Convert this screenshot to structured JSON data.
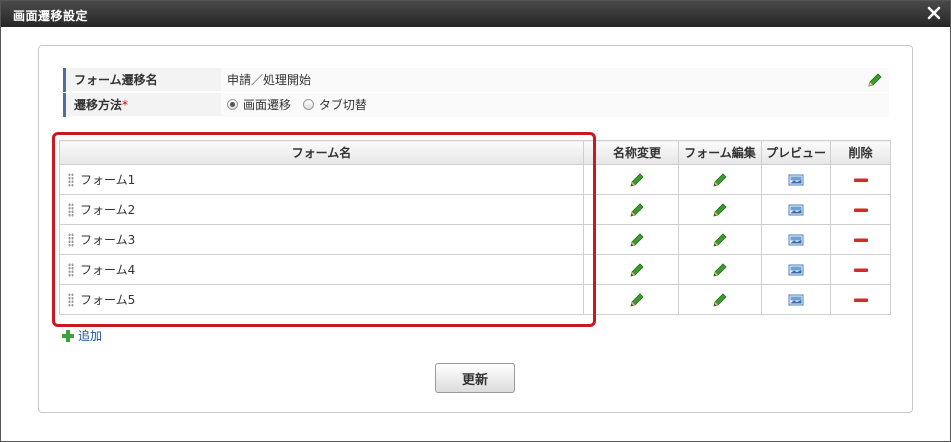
{
  "dialog": {
    "title": "画面遷移設定",
    "close_icon": "close-icon"
  },
  "form": {
    "transition_name_label": "フォーム遷移名",
    "transition_name_value": "申請／処理開始",
    "method_label": "遷移方法",
    "required_mark": "*",
    "method_options": [
      "画面遷移",
      "タブ切替"
    ],
    "method_selected": "画面遷移"
  },
  "table": {
    "headers": [
      "フォーム名",
      "名称変更",
      "フォーム編集",
      "プレビュー",
      "削除"
    ],
    "rows": [
      {
        "name": "フォーム1"
      },
      {
        "name": "フォーム2"
      },
      {
        "name": "フォーム3"
      },
      {
        "name": "フォーム4"
      },
      {
        "name": "フォーム5"
      }
    ],
    "icons": {
      "rename": "pencil-icon",
      "edit": "pencil-icon",
      "preview": "preview-image-icon",
      "delete": "minus-icon"
    }
  },
  "actions": {
    "add_label": "追加",
    "update_label": "更新"
  },
  "colors": {
    "highlight": "#c81820",
    "pencil": "#3b9b2e",
    "delete": "#d32a2a",
    "label_bar": "#4f6e9e"
  }
}
